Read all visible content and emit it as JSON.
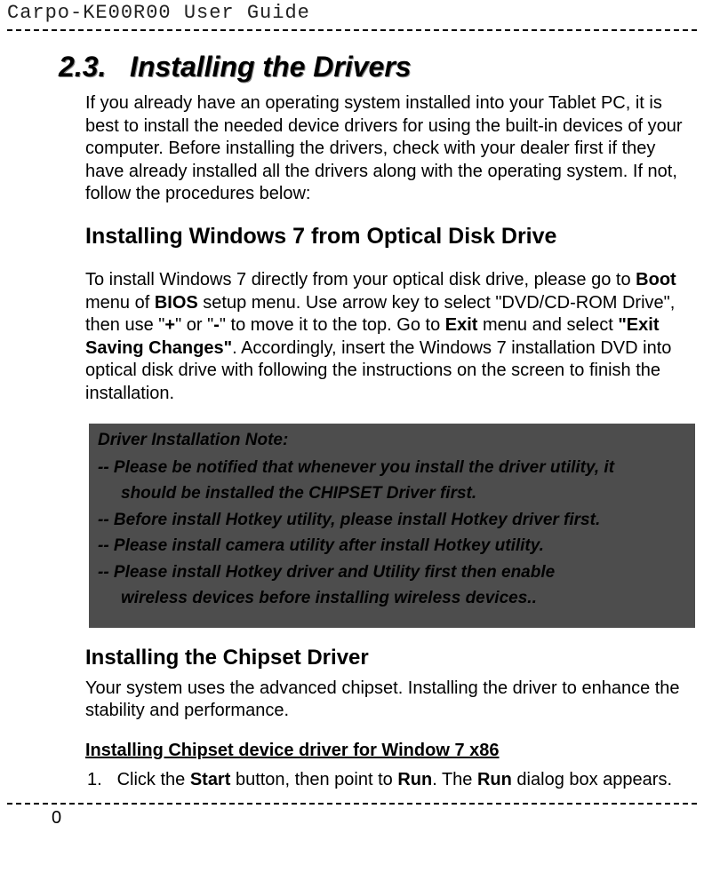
{
  "header": {
    "title": "Carpo-KE00R00  User Guide"
  },
  "section": {
    "number": "2.3.",
    "title": "Installing the Drivers"
  },
  "intro": {
    "text": "If you already have an operating system installed into your Tablet PC, it is best to install the needed device drivers for using the built-in devices of your computer. Before installing the drivers, check with your dealer first if they have already installed all the drivers along with the operating system. If not, follow the procedures below:"
  },
  "win7": {
    "heading": "Installing Windows 7 from Optical Disk Drive",
    "p1_a": "To install Windows 7 directly from your optical disk drive, please go to ",
    "p1_boot": "Boot",
    "p1_b": " menu of ",
    "p1_bios": "BIOS",
    "p1_c": " setup menu. Use arrow key to select \"DVD/CD-ROM Drive\", then use \"",
    "p1_plus": "+",
    "p1_d": "\" or \"",
    "p1_minus": "-",
    "p1_e": "\" to move it to the top. Go to ",
    "p1_exit": "Exit",
    "p1_f": " menu and select ",
    "p1_exitsave": "\"Exit Saving Changes\"",
    "p1_g": ". Accordingly, insert the Windows 7 installation DVD into optical disk drive with following the instructions on the screen to finish the installation."
  },
  "note": {
    "title": "Driver Installation Note:",
    "line1a": "-- Please be notified that whenever you install the driver utility, it",
    "line1b": "should be installed the CHIPSET Driver first.",
    "line2": "-- Before install Hotkey utility, please install Hotkey driver first.",
    "line3": "-- Please install camera utility after install Hotkey utility.",
    "line4a": "-- Please install Hotkey driver and Utility first then enable",
    "line4b": "wireless devices before installing wireless devices.."
  },
  "chipset": {
    "heading": "Installing the Chipset Driver",
    "text": "Your system uses the advanced chipset. Installing the driver to enhance the stability and performance.",
    "subheading": "Installing Chipset device driver for Window 7 x86",
    "step_num": "1.",
    "step1_a": "Click the ",
    "step1_start": "Start",
    "step1_b": " button, then point to ",
    "step1_run": "Run",
    "step1_c": ". The ",
    "step1_run2": "Run",
    "step1_d": " dialog box appears."
  },
  "footer": {
    "page": "0"
  }
}
